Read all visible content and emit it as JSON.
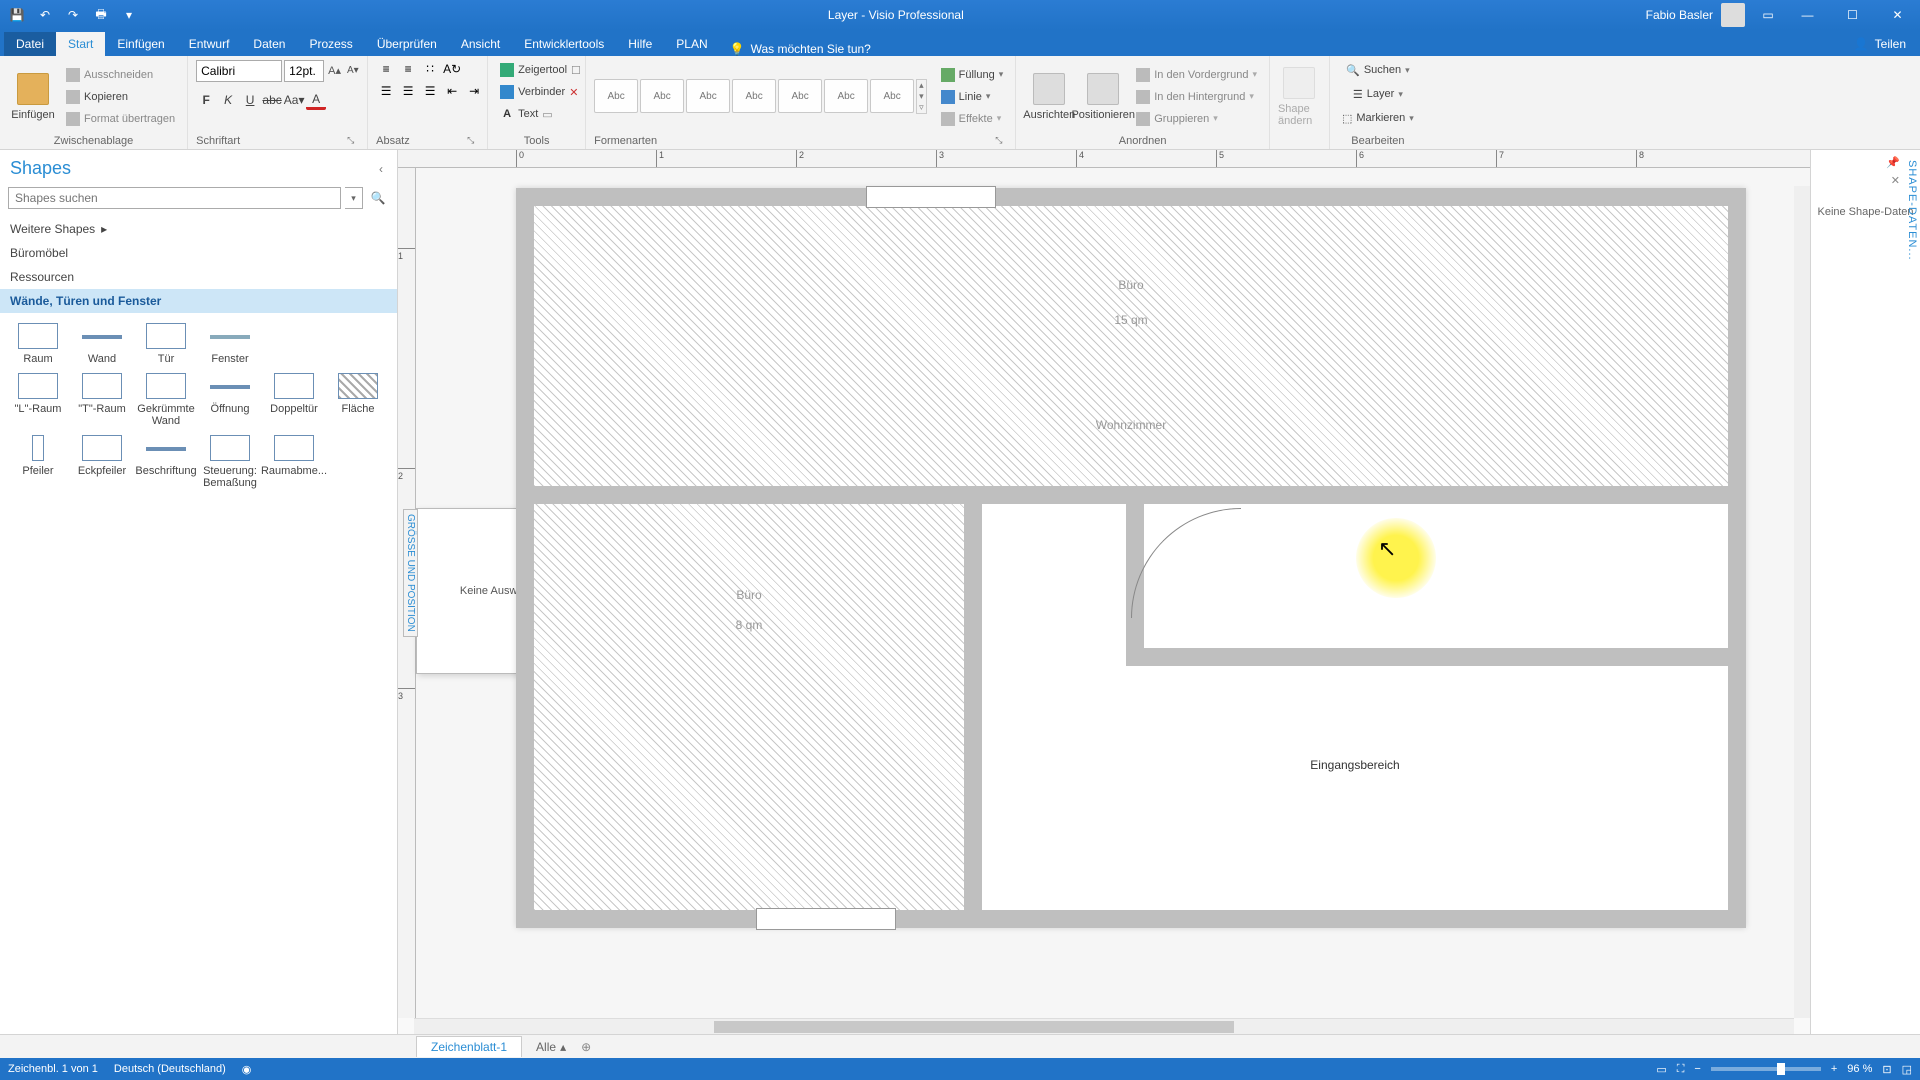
{
  "window": {
    "title": "Layer - Visio Professional",
    "user": "Fabio Basler"
  },
  "tabs": [
    "Datei",
    "Start",
    "Einfügen",
    "Entwurf",
    "Daten",
    "Prozess",
    "Überprüfen",
    "Ansicht",
    "Entwicklertools",
    "Hilfe",
    "PLAN"
  ],
  "active_tab": "Start",
  "tell_me": "Was möchten Sie tun?",
  "share": "Teilen",
  "ribbon": {
    "clipboard": {
      "label": "Zwischenablage",
      "paste": "Einfügen",
      "cut": "Ausschneiden",
      "copy": "Kopieren",
      "format": "Format übertragen"
    },
    "font": {
      "label": "Schriftart",
      "name": "Calibri",
      "size": "12pt."
    },
    "para": {
      "label": "Absatz"
    },
    "tools": {
      "label": "Tools",
      "pointer": "Zeigertool",
      "connector": "Verbinder",
      "text": "Text"
    },
    "styles": {
      "label": "Formenarten",
      "abc": "Abc",
      "fill": "Füllung",
      "line": "Linie",
      "effects": "Effekte"
    },
    "arrange": {
      "label": "Anordnen",
      "align": "Ausrichten",
      "position": "Positionieren",
      "front": "In den Vordergrund",
      "back": "In den Hintergrund",
      "group": "Gruppieren"
    },
    "changeshape": {
      "label": "Shape ändern"
    },
    "edit": {
      "label": "Bearbeiten",
      "find": "Suchen",
      "layer": "Layer",
      "select": "Markieren"
    }
  },
  "shapes_pane": {
    "title": "Shapes",
    "search_placeholder": "Shapes suchen",
    "more": "Weitere Shapes",
    "stencils": [
      "Büromöbel",
      "Ressourcen",
      "Wände, Türen und Fenster"
    ],
    "active_stencil": "Wände, Türen und Fenster",
    "items": [
      "Raum",
      "Wand",
      "Tür",
      "Fenster",
      "\"L\"-Raum",
      "\"T\"-Raum",
      "Gekrümmte Wand",
      "Öffnung",
      "Doppeltür",
      "Fläche",
      "Pfeiler",
      "Eckpfeiler",
      "Beschriftung",
      "Steuerung: Bemaßung",
      "Raumabme..."
    ]
  },
  "side_pane": {
    "title": "SHAPE-DATEN...",
    "msg": "Keine Shape-Daten"
  },
  "size_pos": {
    "title": "GRÖSSE UND POSITION",
    "msg": "Keine Auswahl"
  },
  "drawing": {
    "room1": "Büro",
    "room1_size": "15 qm",
    "room2": "Wohnzimmer",
    "room3": "Büro",
    "room3_size": "8 qm",
    "room4": "Eingangsbereich"
  },
  "ruler_h": [
    "0",
    "1",
    "2",
    "3",
    "4",
    "5",
    "6",
    "7",
    "8"
  ],
  "ruler_v": [
    "1",
    "2",
    "3"
  ],
  "sheet_tab": "Zeichenblatt-1",
  "all_tab": "Alle",
  "status": {
    "page": "Zeichenbl. 1 von 1",
    "lang": "Deutsch (Deutschland)",
    "zoom": "96 %"
  }
}
